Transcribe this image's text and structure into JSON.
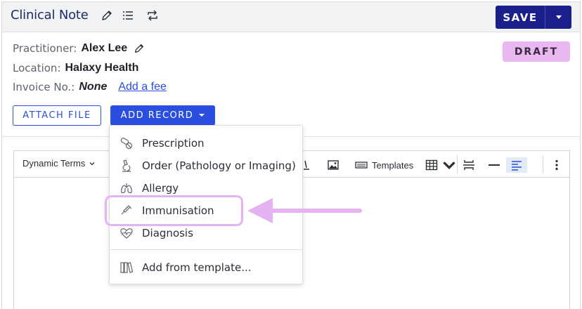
{
  "header": {
    "title": "Clinical Note",
    "save_label": "SAVE"
  },
  "info": {
    "practitioner_label": "Practitioner:",
    "practitioner_value": "Alex Lee",
    "location_label": "Location:",
    "location_value": "Halaxy Health",
    "invoice_label": "Invoice No.:",
    "invoice_value": "None",
    "add_fee_link": "Add a fee"
  },
  "status_badge": "DRAFT",
  "actions": {
    "attach_file": "ATTACH FILE",
    "add_record": "ADD RECORD"
  },
  "toolbar": {
    "dynamic_terms": "Dynamic Terms",
    "templates": "Templates"
  },
  "menu": {
    "items": [
      {
        "label": "Prescription",
        "icon": "pill-icon"
      },
      {
        "label": "Order (Pathology or Imaging)",
        "icon": "microscope-icon"
      },
      {
        "label": "Allergy",
        "icon": "lungs-icon"
      },
      {
        "label": "Immunisation",
        "icon": "syringe-icon"
      },
      {
        "label": "Diagnosis",
        "icon": "heart-pulse-icon"
      }
    ],
    "template_item": {
      "label": "Add from template...",
      "icon": "books-icon"
    }
  },
  "colors": {
    "save_button": "#1a1f8c",
    "primary_blue": "#2a4fe0",
    "draft_badge": "#eab8f0",
    "annotation_highlight": "#e6b3f2"
  }
}
